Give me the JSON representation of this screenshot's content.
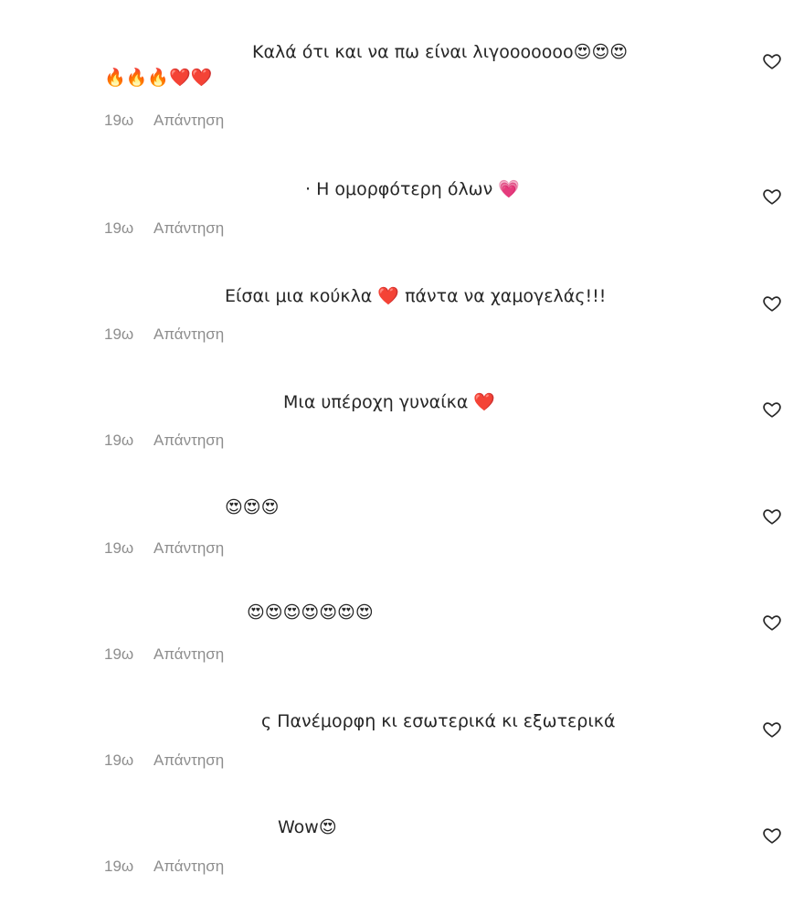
{
  "comments": [
    {
      "text": "Καλά ότι και να πω είναι λιγοοοοοοο😍😍😍",
      "text_line2": "🔥🔥🔥❤️❤️",
      "time": "19ω",
      "reply": "Απάντηση"
    },
    {
      "text": "· Η ομορφότερη όλων 💗",
      "time": "19ω",
      "reply": "Απάντηση"
    },
    {
      "text": "Είσαι μια κούκλα ❤️ πάντα να χαμογελάς!!!",
      "time": "19ω",
      "reply": "Απάντηση"
    },
    {
      "text": "Μια υπέροχη γυναίκα ❤️",
      "time": "19ω",
      "reply": "Απάντηση"
    },
    {
      "text": "😍😍😍",
      "time": "19ω",
      "reply": "Απάντηση"
    },
    {
      "text": "😍😍😍😍😍😍😍",
      "time": "19ω",
      "reply": "Απάντηση"
    },
    {
      "text": "ς Πανέμορφη κι εσωτερικά κι εξωτερικά",
      "time": "19ω",
      "reply": "Απάντηση"
    },
    {
      "text": "Wow😍",
      "time": "19ω",
      "reply": "Απάντηση"
    }
  ],
  "icons": {
    "like": "heart-outline-icon"
  },
  "colors": {
    "text": "#262626",
    "meta": "#8e8e8e"
  }
}
